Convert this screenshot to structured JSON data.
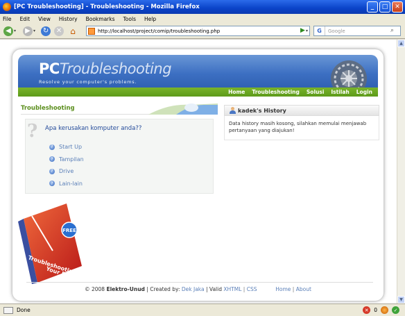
{
  "window": {
    "title": "[PC Troubleshooting] - Troubleshooting - Mozilla Firefox",
    "min": "_",
    "max": "□",
    "close": "✕"
  },
  "menu": [
    "File",
    "Edit",
    "View",
    "History",
    "Bookmarks",
    "Tools",
    "Help"
  ],
  "nav": {
    "url": "http://localhost/project/comip/troubleshooting.php",
    "search_placeholder": "Google",
    "search_engine_label": "G"
  },
  "site": {
    "logo_pc": "PC",
    "logo_brand": "Troubleshooting",
    "tagline": "Resolve your computer's problems.",
    "nav": [
      "Home",
      "Troubleshooting",
      "Solusi",
      "Istilah",
      "Login"
    ]
  },
  "troubleshooting": {
    "title": "Troubleshooting",
    "question": "Apa kerusakan komputer anda??",
    "items": [
      "Start Up",
      "Tampilan",
      "Drive",
      "Lain-lain"
    ]
  },
  "history": {
    "title": "kadek's History",
    "body": "Data history masih kosong, silahkan memulai menjawab pertanyaan yang diajukan!"
  },
  "book": {
    "badge": "FREE",
    "title": "Troubleshooting",
    "subtitle": "Your PC"
  },
  "footer": {
    "copyright": "© 2008",
    "org": "Elektro-Unud",
    "created_by": "| Created by:",
    "author": "Dek Jaka",
    "valid": "| Valid",
    "xhtml": "XHTML",
    "css": "CSS",
    "home": "Home",
    "about": "About"
  },
  "status": {
    "text": "Done",
    "count": "0"
  },
  "colors": {
    "accent_blue": "#3c6fc2",
    "nav_green": "#6aaa22",
    "link": "#5a7fb8"
  }
}
